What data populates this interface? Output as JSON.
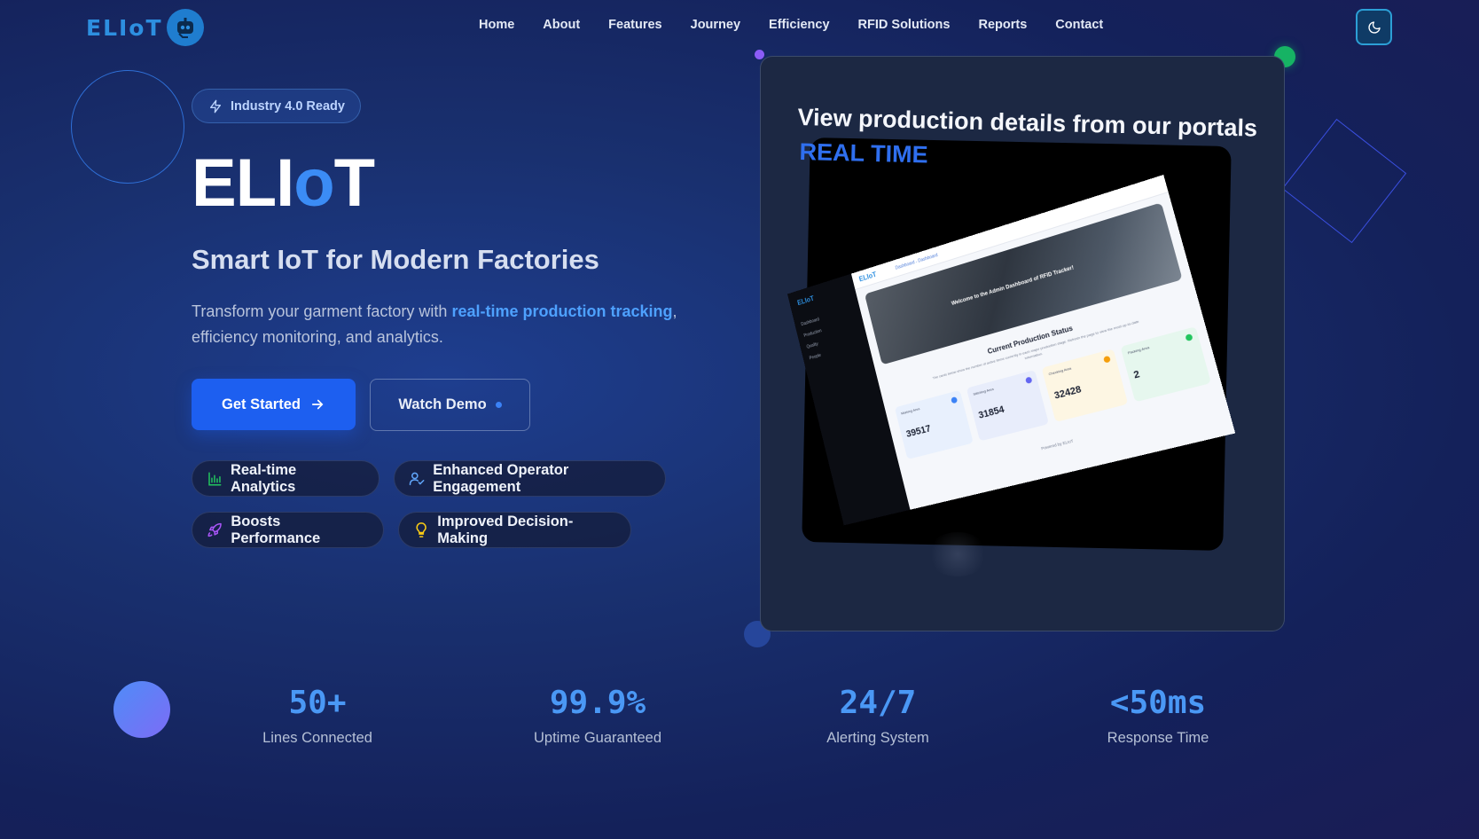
{
  "nav": {
    "logo_text": "ELIoT",
    "items": [
      "Home",
      "About",
      "Features",
      "Journey",
      "Efficiency",
      "RFID Solutions",
      "Reports",
      "Contact"
    ],
    "theme_toggle_icon": "moon-icon"
  },
  "hero": {
    "badge": "Industry 4.0 Ready",
    "title_part1": "ELI",
    "title_part2": "o",
    "title_part3": "T",
    "subtitle": "Smart IoT for Modern Factories",
    "desc_before": "Transform your garment factory with ",
    "desc_highlight": "real-time production tracking",
    "desc_after": ", efficiency monitoring, and analytics.",
    "cta_primary": "Get Started",
    "cta_secondary": "Watch Demo",
    "chips": [
      {
        "label": "Real-time Analytics",
        "icon": "bar-chart-icon",
        "color": "#22c55e"
      },
      {
        "label": "Enhanced Operator Engagement",
        "icon": "user-check-icon",
        "color": "#60a5fa"
      },
      {
        "label": "Boosts Performance",
        "icon": "rocket-icon",
        "color": "#a855f7"
      },
      {
        "label": "Improved Decision-Making",
        "icon": "lightbulb-icon",
        "color": "#facc15"
      }
    ]
  },
  "preview": {
    "heading": "View production details from our portals",
    "heading_accent": "REAL TIME",
    "dashboard": {
      "logo": "ELIoT",
      "breadcrumb": "Dashboard - Dashboard",
      "welcome": "Welcome to the Admin Dashboard of RFID Tracker!",
      "status_title": "Current Production Status",
      "status_sub": "The cards below show the number of active items currently in each major production stage. Refresh the page to view the most up-to-date information.",
      "cards": [
        {
          "label": "Marking Area",
          "value": "39517",
          "bg": "#e8f0fd",
          "icon_color": "#3b82f6"
        },
        {
          "label": "Stitching Area",
          "value": "31854",
          "bg": "#e8edfb",
          "icon_color": "#6366f1"
        },
        {
          "label": "Checking Area",
          "value": "32428",
          "bg": "#fdf6e3",
          "icon_color": "#f59e0b"
        },
        {
          "label": "Packing Area",
          "value": "2",
          "bg": "#e6f7ee",
          "icon_color": "#22c55e"
        }
      ],
      "sidebar_items": [
        "Dashboard",
        "Production",
        "Quality",
        "People"
      ],
      "footer": "Powered by ELIoT"
    }
  },
  "stats": [
    {
      "value": "50+",
      "label": "Lines Connected"
    },
    {
      "value": "99.9%",
      "label": "Uptime Guaranteed"
    },
    {
      "value": "24/7",
      "label": "Alerting System"
    },
    {
      "value": "<50ms",
      "label": "Response Time"
    }
  ]
}
